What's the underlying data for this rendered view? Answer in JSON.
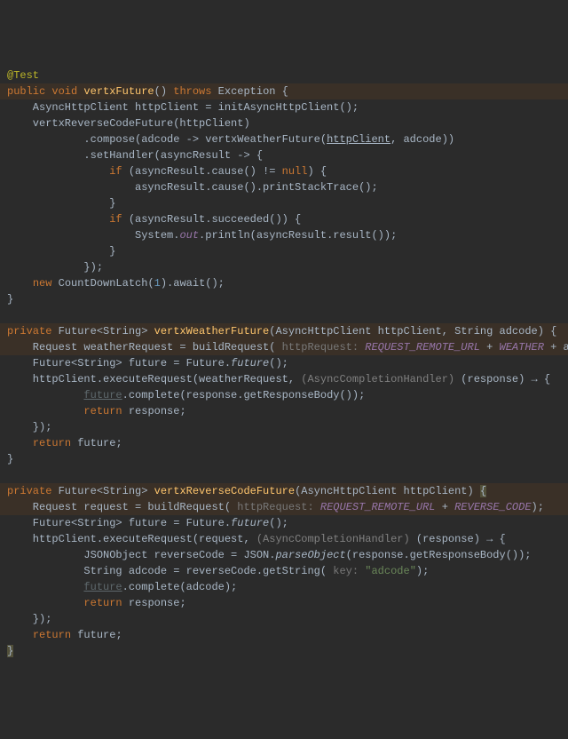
{
  "l1": {
    "ann": "@Test"
  },
  "l2": {
    "kw1": "public void ",
    "m": "vertxFuture",
    "s1": "() ",
    "kw2": "throws ",
    "s2": "Exception {"
  },
  "l3": {
    "t1": "    AsyncHttpClient httpClient = initAsyncHttpClient();"
  },
  "l4": {
    "t1": "    vertxReverseCodeFuture(httpClient)"
  },
  "l5": {
    "t1": "            .compose(adcode -> vertxWeatherFuture(",
    "u1": "httpClient",
    "t2": ", adcode))"
  },
  "l6": {
    "t1": "            .setHandler(asyncResult -> {"
  },
  "l7": {
    "t1": "                ",
    "kw": "if ",
    "t2": "(asyncResult.cause() != ",
    "kw2": "null",
    "t3": ") {"
  },
  "l8": {
    "t1": "                    asyncResult.cause().printStackTrace();"
  },
  "l9": {
    "t1": "                }"
  },
  "l10": {
    "t1": "                ",
    "kw": "if ",
    "t2": "(asyncResult.succeeded()) {"
  },
  "l11": {
    "t1": "                    System.",
    "f": "out",
    "t2": ".println(asyncResult.result());"
  },
  "l12": {
    "t1": "                }"
  },
  "l13": {
    "t1": "            });"
  },
  "l14": {
    "t1": "    ",
    "kw": "new ",
    "t2": "CountDownLatch(",
    "n": "1",
    "t3": ").await();"
  },
  "l15": {
    "t1": "}"
  },
  "l17": {
    "kw": "private ",
    "t1": "Future<String> ",
    "m": "vertxWeatherFuture",
    "t2": "(AsyncHttpClient httpClient, String adcode) {"
  },
  "l18": {
    "t1": "    Request weatherRequest = buildRequest(",
    "h": " httpRequest: ",
    "f1": "REQUEST_REMOTE_URL",
    "p1": " + ",
    "f2": "WEATHER",
    "p2": " + adcode);"
  },
  "l19": {
    "t1": "    Future<String> future = Future.",
    "m": "future",
    "t2": "();"
  },
  "l20": {
    "t1": "    httpClient.executeRequest(weatherRequest, ",
    "c": "(AsyncCompletionHandler)",
    "t2": " (response) → {"
  },
  "l21": {
    "t1": "            ",
    "u": "future",
    "t2": ".complete(response.getResponseBody());"
  },
  "l22": {
    "t1": "            ",
    "kw": "return ",
    "t2": "response;"
  },
  "l23": {
    "t1": "    });"
  },
  "l24": {
    "t1": "    ",
    "kw": "return ",
    "t2": "future;"
  },
  "l25": {
    "t1": "}"
  },
  "l27": {
    "kw": "private ",
    "t1": "Future<String> ",
    "m": "vertxReverseCodeFuture",
    "t2": "(AsyncHttpClient httpClient) ",
    "b": "{"
  },
  "l28": {
    "t1": "    Request request = buildRequest(",
    "h": " httpRequest: ",
    "f1": "REQUEST_REMOTE_URL",
    "p1": " + ",
    "f2": "REVERSE_CODE",
    "t2": ");"
  },
  "l29": {
    "t1": "    Future<String> future = Future.",
    "m": "future",
    "t2": "();"
  },
  "l30": {
    "t1": "    httpClient.executeRequest(request, ",
    "c": "(AsyncCompletionHandler)",
    "t2": " (response) → {"
  },
  "l31": {
    "t1": "            JSONObject reverseCode = JSON.",
    "m": "parseObject",
    "t2": "(response.getResponseBody());"
  },
  "l32": {
    "t1": "            String adcode = reverseCode.getString(",
    "h": " key: ",
    "s": "\"adcode\"",
    "t2": ");"
  },
  "l33": {
    "t1": "            ",
    "u": "future",
    "t2": ".complete(adcode);"
  },
  "l34": {
    "t1": "            ",
    "kw": "return ",
    "t2": "response;"
  },
  "l35": {
    "t1": "    });"
  },
  "l36": {
    "t1": "    ",
    "kw": "return ",
    "t2": "future;"
  },
  "l37": {
    "b": "}"
  }
}
